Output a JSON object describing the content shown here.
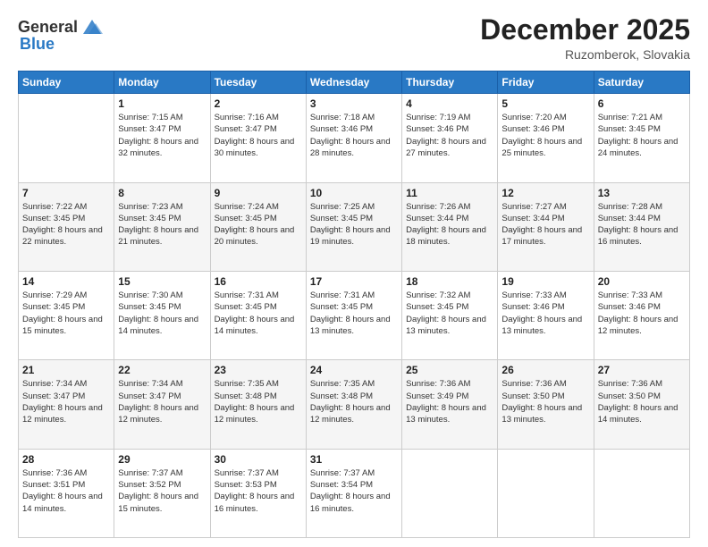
{
  "header": {
    "logo_general": "General",
    "logo_blue": "Blue",
    "month_year": "December 2025",
    "location": "Ruzomberok, Slovakia"
  },
  "days_of_week": [
    "Sunday",
    "Monday",
    "Tuesday",
    "Wednesday",
    "Thursday",
    "Friday",
    "Saturday"
  ],
  "weeks": [
    [
      {
        "day": "",
        "sunrise": "",
        "sunset": "",
        "daylight": ""
      },
      {
        "day": "1",
        "sunrise": "Sunrise: 7:15 AM",
        "sunset": "Sunset: 3:47 PM",
        "daylight": "Daylight: 8 hours and 32 minutes."
      },
      {
        "day": "2",
        "sunrise": "Sunrise: 7:16 AM",
        "sunset": "Sunset: 3:47 PM",
        "daylight": "Daylight: 8 hours and 30 minutes."
      },
      {
        "day": "3",
        "sunrise": "Sunrise: 7:18 AM",
        "sunset": "Sunset: 3:46 PM",
        "daylight": "Daylight: 8 hours and 28 minutes."
      },
      {
        "day": "4",
        "sunrise": "Sunrise: 7:19 AM",
        "sunset": "Sunset: 3:46 PM",
        "daylight": "Daylight: 8 hours and 27 minutes."
      },
      {
        "day": "5",
        "sunrise": "Sunrise: 7:20 AM",
        "sunset": "Sunset: 3:46 PM",
        "daylight": "Daylight: 8 hours and 25 minutes."
      },
      {
        "day": "6",
        "sunrise": "Sunrise: 7:21 AM",
        "sunset": "Sunset: 3:45 PM",
        "daylight": "Daylight: 8 hours and 24 minutes."
      }
    ],
    [
      {
        "day": "7",
        "sunrise": "Sunrise: 7:22 AM",
        "sunset": "Sunset: 3:45 PM",
        "daylight": "Daylight: 8 hours and 22 minutes."
      },
      {
        "day": "8",
        "sunrise": "Sunrise: 7:23 AM",
        "sunset": "Sunset: 3:45 PM",
        "daylight": "Daylight: 8 hours and 21 minutes."
      },
      {
        "day": "9",
        "sunrise": "Sunrise: 7:24 AM",
        "sunset": "Sunset: 3:45 PM",
        "daylight": "Daylight: 8 hours and 20 minutes."
      },
      {
        "day": "10",
        "sunrise": "Sunrise: 7:25 AM",
        "sunset": "Sunset: 3:45 PM",
        "daylight": "Daylight: 8 hours and 19 minutes."
      },
      {
        "day": "11",
        "sunrise": "Sunrise: 7:26 AM",
        "sunset": "Sunset: 3:44 PM",
        "daylight": "Daylight: 8 hours and 18 minutes."
      },
      {
        "day": "12",
        "sunrise": "Sunrise: 7:27 AM",
        "sunset": "Sunset: 3:44 PM",
        "daylight": "Daylight: 8 hours and 17 minutes."
      },
      {
        "day": "13",
        "sunrise": "Sunrise: 7:28 AM",
        "sunset": "Sunset: 3:44 PM",
        "daylight": "Daylight: 8 hours and 16 minutes."
      }
    ],
    [
      {
        "day": "14",
        "sunrise": "Sunrise: 7:29 AM",
        "sunset": "Sunset: 3:45 PM",
        "daylight": "Daylight: 8 hours and 15 minutes."
      },
      {
        "day": "15",
        "sunrise": "Sunrise: 7:30 AM",
        "sunset": "Sunset: 3:45 PM",
        "daylight": "Daylight: 8 hours and 14 minutes."
      },
      {
        "day": "16",
        "sunrise": "Sunrise: 7:31 AM",
        "sunset": "Sunset: 3:45 PM",
        "daylight": "Daylight: 8 hours and 14 minutes."
      },
      {
        "day": "17",
        "sunrise": "Sunrise: 7:31 AM",
        "sunset": "Sunset: 3:45 PM",
        "daylight": "Daylight: 8 hours and 13 minutes."
      },
      {
        "day": "18",
        "sunrise": "Sunrise: 7:32 AM",
        "sunset": "Sunset: 3:45 PM",
        "daylight": "Daylight: 8 hours and 13 minutes."
      },
      {
        "day": "19",
        "sunrise": "Sunrise: 7:33 AM",
        "sunset": "Sunset: 3:46 PM",
        "daylight": "Daylight: 8 hours and 13 minutes."
      },
      {
        "day": "20",
        "sunrise": "Sunrise: 7:33 AM",
        "sunset": "Sunset: 3:46 PM",
        "daylight": "Daylight: 8 hours and 12 minutes."
      }
    ],
    [
      {
        "day": "21",
        "sunrise": "Sunrise: 7:34 AM",
        "sunset": "Sunset: 3:47 PM",
        "daylight": "Daylight: 8 hours and 12 minutes."
      },
      {
        "day": "22",
        "sunrise": "Sunrise: 7:34 AM",
        "sunset": "Sunset: 3:47 PM",
        "daylight": "Daylight: 8 hours and 12 minutes."
      },
      {
        "day": "23",
        "sunrise": "Sunrise: 7:35 AM",
        "sunset": "Sunset: 3:48 PM",
        "daylight": "Daylight: 8 hours and 12 minutes."
      },
      {
        "day": "24",
        "sunrise": "Sunrise: 7:35 AM",
        "sunset": "Sunset: 3:48 PM",
        "daylight": "Daylight: 8 hours and 12 minutes."
      },
      {
        "day": "25",
        "sunrise": "Sunrise: 7:36 AM",
        "sunset": "Sunset: 3:49 PM",
        "daylight": "Daylight: 8 hours and 13 minutes."
      },
      {
        "day": "26",
        "sunrise": "Sunrise: 7:36 AM",
        "sunset": "Sunset: 3:50 PM",
        "daylight": "Daylight: 8 hours and 13 minutes."
      },
      {
        "day": "27",
        "sunrise": "Sunrise: 7:36 AM",
        "sunset": "Sunset: 3:50 PM",
        "daylight": "Daylight: 8 hours and 14 minutes."
      }
    ],
    [
      {
        "day": "28",
        "sunrise": "Sunrise: 7:36 AM",
        "sunset": "Sunset: 3:51 PM",
        "daylight": "Daylight: 8 hours and 14 minutes."
      },
      {
        "day": "29",
        "sunrise": "Sunrise: 7:37 AM",
        "sunset": "Sunset: 3:52 PM",
        "daylight": "Daylight: 8 hours and 15 minutes."
      },
      {
        "day": "30",
        "sunrise": "Sunrise: 7:37 AM",
        "sunset": "Sunset: 3:53 PM",
        "daylight": "Daylight: 8 hours and 16 minutes."
      },
      {
        "day": "31",
        "sunrise": "Sunrise: 7:37 AM",
        "sunset": "Sunset: 3:54 PM",
        "daylight": "Daylight: 8 hours and 16 minutes."
      },
      {
        "day": "",
        "sunrise": "",
        "sunset": "",
        "daylight": ""
      },
      {
        "day": "",
        "sunrise": "",
        "sunset": "",
        "daylight": ""
      },
      {
        "day": "",
        "sunrise": "",
        "sunset": "",
        "daylight": ""
      }
    ]
  ]
}
